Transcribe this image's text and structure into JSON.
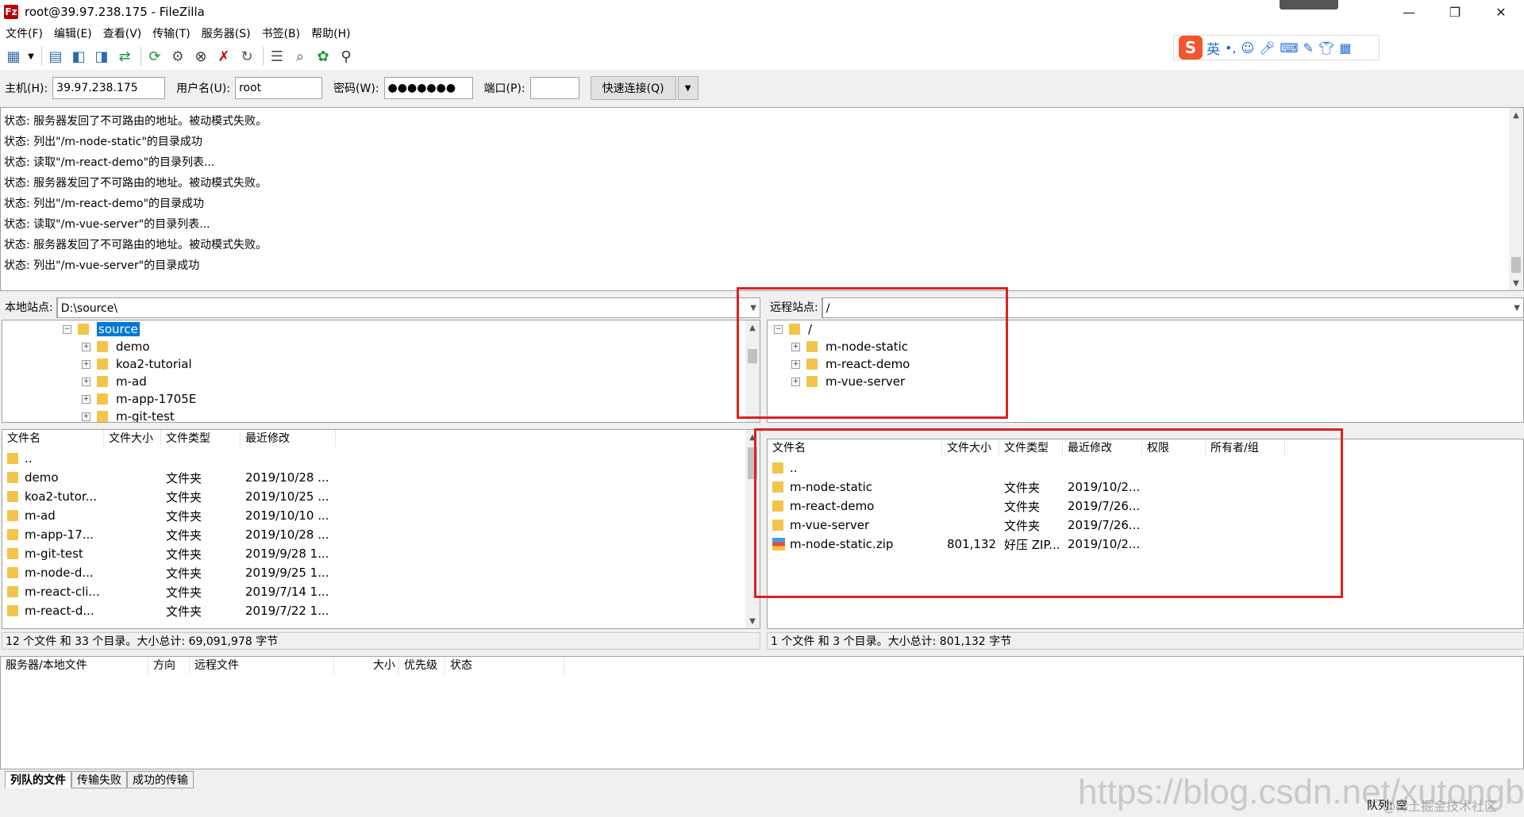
{
  "window": {
    "title": "root@39.97.238.175 - FileZilla",
    "minimize": "—",
    "maximize": "❐",
    "close": "✕"
  },
  "menu": [
    "文件(F)",
    "编辑(E)",
    "查看(V)",
    "传输(T)",
    "服务器(S)",
    "书签(B)",
    "帮助(H)"
  ],
  "ime": {
    "logo": "S",
    "lang": "英"
  },
  "quickconnect": {
    "host_label": "主机(H):",
    "host_value": "39.97.238.175",
    "user_label": "用户名(U):",
    "user_value": "root",
    "pass_label": "密码(W):",
    "pass_value": "●●●●●●●",
    "port_label": "端口(P):",
    "port_value": "",
    "connect_label": "快速连接(Q)"
  },
  "log": [
    "状态:  服务器发回了不可路由的地址。被动模式失败。",
    "状态:  列出\"/m-node-static\"的目录成功",
    "状态:  读取\"/m-react-demo\"的目录列表...",
    "状态:  服务器发回了不可路由的地址。被动模式失败。",
    "状态:  列出\"/m-react-demo\"的目录成功",
    "状态:  读取\"/m-vue-server\"的目录列表...",
    "状态:  服务器发回了不可路由的地址。被动模式失败。",
    "状态:  列出\"/m-vue-server\"的目录成功"
  ],
  "local": {
    "site_label": "本地站点:",
    "path": "D:\\source\\",
    "tree": [
      "source",
      "demo",
      "koa2-tutorial",
      "m-ad",
      "m-app-1705E",
      "m-git-test"
    ],
    "columns": [
      "文件名",
      "文件大小",
      "文件类型",
      "最近修改"
    ],
    "files": [
      {
        "name": "..",
        "size": "",
        "type": "",
        "modified": ""
      },
      {
        "name": "demo",
        "size": "",
        "type": "文件夹",
        "modified": "2019/10/28 ..."
      },
      {
        "name": "koa2-tutor...",
        "size": "",
        "type": "文件夹",
        "modified": "2019/10/25 ..."
      },
      {
        "name": "m-ad",
        "size": "",
        "type": "文件夹",
        "modified": "2019/10/10 ..."
      },
      {
        "name": "m-app-17...",
        "size": "",
        "type": "文件夹",
        "modified": "2019/10/28 ..."
      },
      {
        "name": "m-git-test",
        "size": "",
        "type": "文件夹",
        "modified": "2019/9/28 1..."
      },
      {
        "name": "m-node-d...",
        "size": "",
        "type": "文件夹",
        "modified": "2019/9/25 1..."
      },
      {
        "name": "m-react-cli...",
        "size": "",
        "type": "文件夹",
        "modified": "2019/7/14 1..."
      },
      {
        "name": "m-react-d...",
        "size": "",
        "type": "文件夹",
        "modified": "2019/7/22 1..."
      }
    ],
    "status": "12 个文件 和 33 个目录。大小总计: 69,091,978 字节"
  },
  "remote": {
    "site_label": "远程站点:",
    "path": "/",
    "tree": [
      "/",
      "m-node-static",
      "m-react-demo",
      "m-vue-server"
    ],
    "columns": [
      "文件名",
      "文件大小",
      "文件类型",
      "最近修改",
      "权限",
      "所有者/组"
    ],
    "files": [
      {
        "name": "..",
        "size": "",
        "type": "",
        "modified": "",
        "perm": "",
        "owner": "",
        "icon": "folder"
      },
      {
        "name": "m-node-static",
        "size": "",
        "type": "文件夹",
        "modified": "2019/10/2...",
        "perm": "",
        "owner": "",
        "icon": "folder"
      },
      {
        "name": "m-react-demo",
        "size": "",
        "type": "文件夹",
        "modified": "2019/7/26...",
        "perm": "",
        "owner": "",
        "icon": "folder"
      },
      {
        "name": "m-vue-server",
        "size": "",
        "type": "文件夹",
        "modified": "2019/7/26...",
        "perm": "",
        "owner": "",
        "icon": "folder"
      },
      {
        "name": "m-node-static.zip",
        "size": "801,132",
        "type": "好压 ZIP...",
        "modified": "2019/10/2...",
        "perm": "",
        "owner": "",
        "icon": "zip"
      }
    ],
    "status": "1 个文件 和 3 个目录。大小总计: 801,132 字节"
  },
  "queue": {
    "columns": [
      "服务器/本地文件",
      "方向",
      "远程文件",
      "大小",
      "优先级",
      "状态"
    ],
    "tabs": [
      "列队的文件",
      "传输失败",
      "成功的传输"
    ],
    "status": "队列: 空"
  },
  "watermark": "https://blog.csdn.net/xutongbao",
  "watermark2": "@稀土掘金技术社区",
  "accent": "#e02020"
}
